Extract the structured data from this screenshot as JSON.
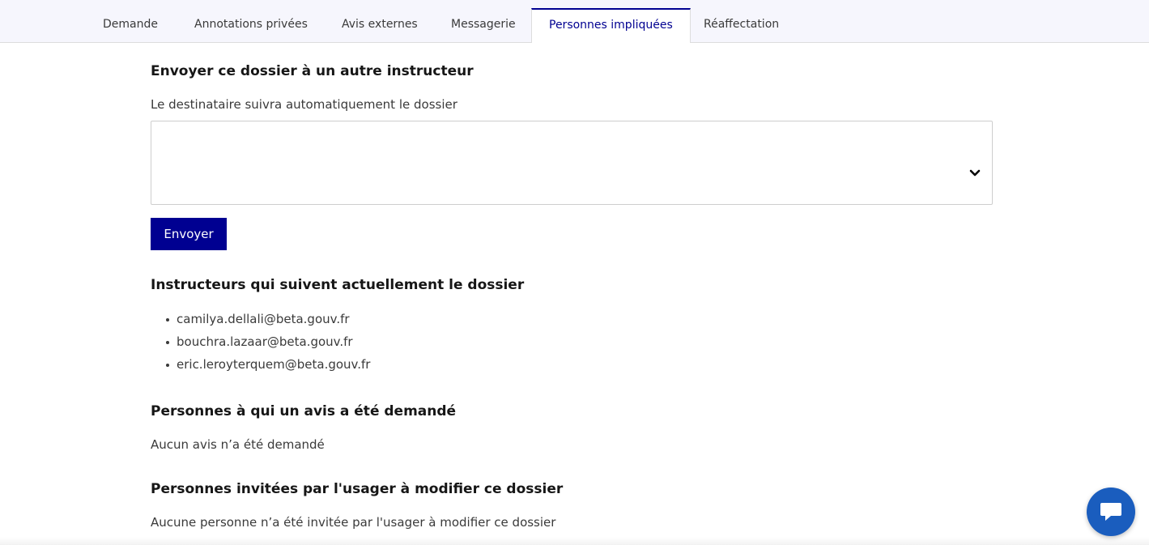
{
  "tabs": [
    {
      "label": "Demande"
    },
    {
      "label": "Annotations privées"
    },
    {
      "label": "Avis externes"
    },
    {
      "label": "Messagerie"
    },
    {
      "label": "Personnes impliquées"
    },
    {
      "label": "Réaffectation"
    }
  ],
  "active_tab": "Personnes impliquées",
  "send_section": {
    "title": "Envoyer ce dossier à un autre instructeur",
    "hint": "Le destinataire suivra automatiquement le dossier",
    "select_value": "",
    "button_label": "Envoyer"
  },
  "followers_section": {
    "title": "Instructeurs qui suivent actuellement le dossier",
    "emails": [
      "camilya.dellali@beta.gouv.fr",
      "bouchra.lazaar@beta.gouv.fr",
      "eric.leroyterquem@beta.gouv.fr"
    ]
  },
  "avis_section": {
    "title": "Personnes à qui un avis a été demandé",
    "empty_text": "Aucun avis n’a été demandé"
  },
  "invites_section": {
    "title": "Personnes invitées par l'usager à modifier ce dossier",
    "empty_text": "Aucune personne n’a été invitée par l'usager à modifier ce dossier"
  },
  "colors": {
    "accent": "#000091",
    "chat_button": "#1a5dbe",
    "tabbar_bg": "#f6f6fd"
  },
  "icons": {
    "select_arrow": "chevron-down-icon",
    "chat": "chat-bubble-icon"
  }
}
